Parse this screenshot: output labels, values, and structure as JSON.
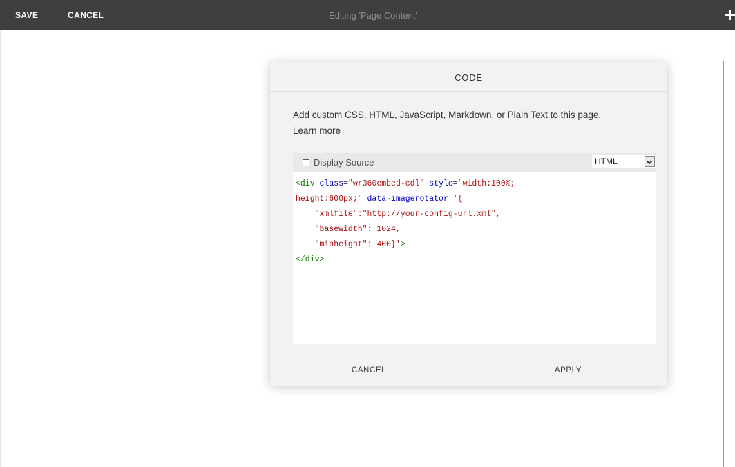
{
  "toolbar": {
    "save_label": "SAVE",
    "cancel_label": "CANCEL",
    "title": "Editing 'Page Content'",
    "add_icon": "plus-icon"
  },
  "dialog": {
    "title": "CODE",
    "description": "Add custom CSS, HTML, JavaScript, Markdown, or Plain Text to this page.",
    "learn_more": "Learn more",
    "display_source_label": "Display Source",
    "display_source_checked": false,
    "language": "HTML",
    "code_lines": [
      [
        {
          "t": "<div ",
          "c": "tag"
        },
        {
          "t": "class",
          "c": "attr"
        },
        {
          "t": "=",
          "c": "plain"
        },
        {
          "t": "\"wr360embed-cdl\"",
          "c": "str"
        },
        {
          "t": " style",
          "c": "attr"
        },
        {
          "t": "=",
          "c": "plain"
        },
        {
          "t": "\"width:100%;",
          "c": "str"
        }
      ],
      [
        {
          "t": "height:600px;\"",
          "c": "str"
        },
        {
          "t": " data-imagerotator",
          "c": "attr"
        },
        {
          "t": "=",
          "c": "plain"
        },
        {
          "t": "'{",
          "c": "str"
        }
      ],
      [
        {
          "t": "    \"xmlfile\":\"http://your-config-url.xml\",",
          "c": "str"
        }
      ],
      [
        {
          "t": "    \"basewidth\": 1024,",
          "c": "str"
        }
      ],
      [
        {
          "t": "    \"minheight\": 400}'",
          "c": "str"
        },
        {
          "t": ">",
          "c": "tag"
        }
      ],
      [
        {
          "t": "</div>",
          "c": "tag"
        }
      ]
    ],
    "cancel_label": "CANCEL",
    "apply_label": "APPLY"
  }
}
